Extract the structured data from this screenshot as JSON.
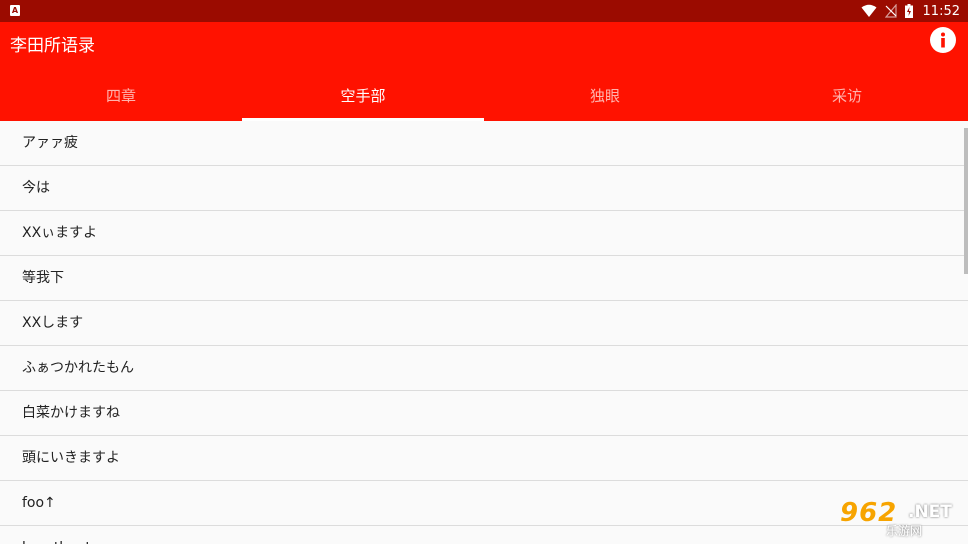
{
  "status_bar": {
    "left_icon": "A",
    "time": "11:52",
    "icons": [
      "wifi-icon",
      "no-signal-icon",
      "battery-charging-icon"
    ]
  },
  "app_bar": {
    "title": "李田所语录",
    "info_icon": "info-icon"
  },
  "tabs": [
    {
      "label": "四章",
      "active": false
    },
    {
      "label": "空手部",
      "active": true
    },
    {
      "label": "独眼",
      "active": false
    },
    {
      "label": "采访",
      "active": false
    }
  ],
  "list": [
    "アァァ疲",
    "今は",
    "XXぃますよ",
    "等我下",
    "XXします",
    "ふぁつかれたもん",
    "白菜かけますね",
    "頭にいきますよ",
    "foo↑",
    "heartbeat"
  ],
  "watermark": {
    "number": "962",
    "domain": ".NET",
    "caption": "乐游网"
  },
  "colors": {
    "status_bar": "#9b0b00",
    "app_bar": "#ff1200",
    "tab_inactive": "#ffb3ad",
    "tab_active": "#ffffff"
  }
}
